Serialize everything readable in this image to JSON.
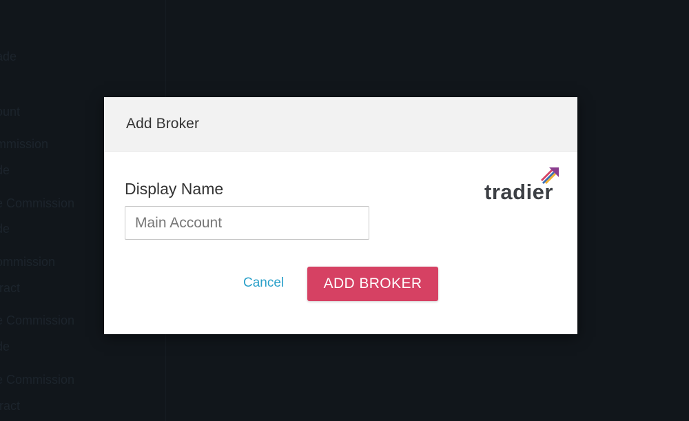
{
  "background": {
    "sidebar_items": [
      "ade",
      "ount",
      "mmission",
      "de",
      "e Commission",
      "de",
      "ommission",
      "tract",
      "e Commission",
      "de",
      "e Commission",
      "tract"
    ]
  },
  "dialog": {
    "title": "Add Broker",
    "field_label": "Display Name",
    "input_value": "",
    "input_placeholder": "Main Account",
    "logo_text": "tradier",
    "cancel_label": "Cancel",
    "submit_label": "ADD BROKER"
  },
  "colors": {
    "accent": "#d64163",
    "link": "#2aa0c9",
    "header_bg": "#f2f2f2",
    "backdrop": "#11161b"
  }
}
